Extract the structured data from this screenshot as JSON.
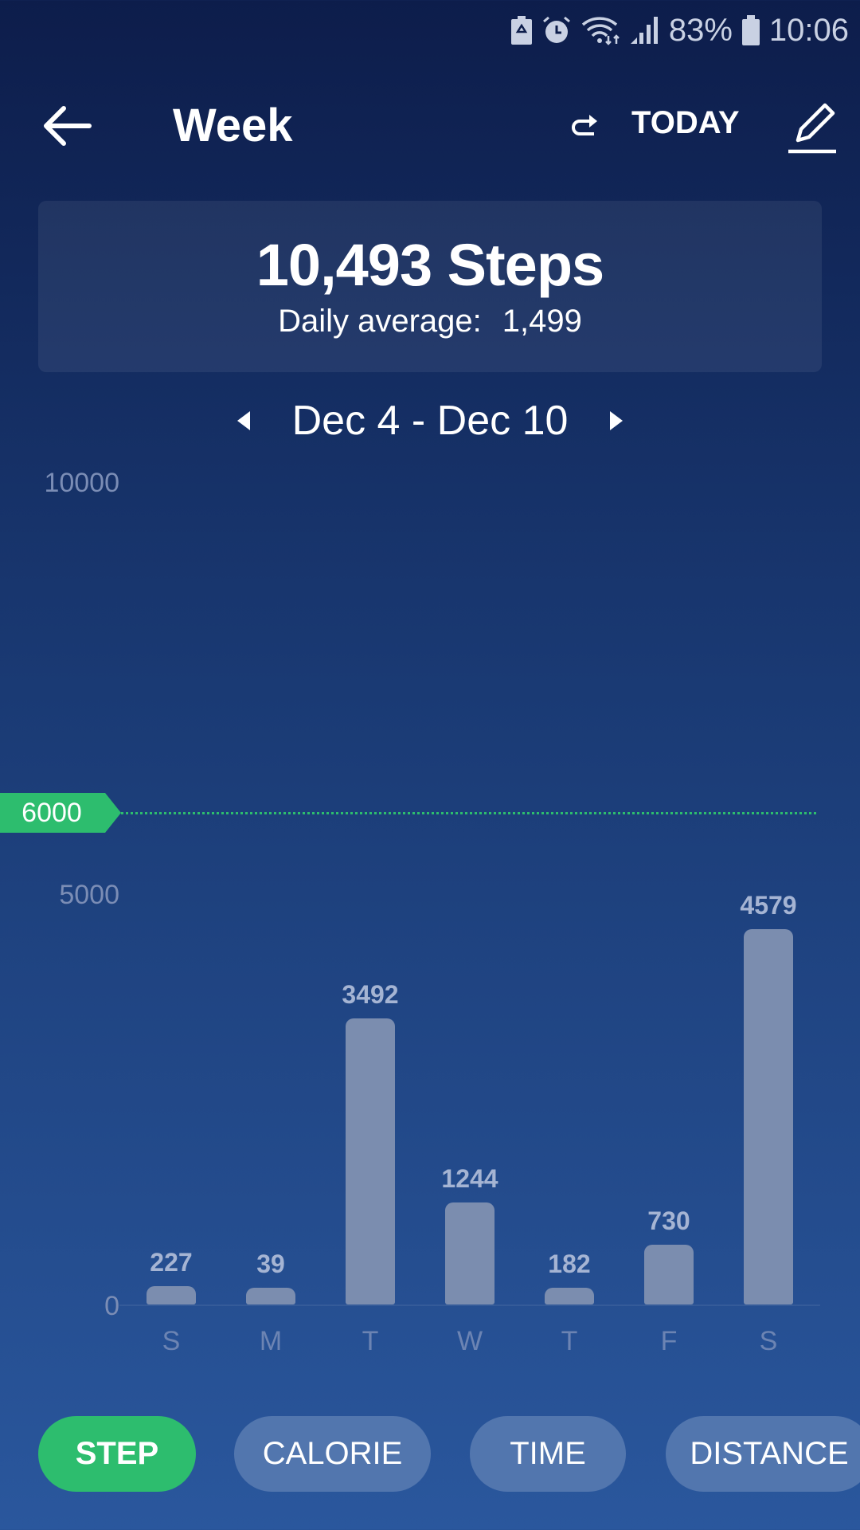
{
  "status_bar": {
    "battery_percent": "83%",
    "time": "10:06",
    "icons": [
      "battery-saver-icon",
      "alarm-icon",
      "wifi-icon",
      "signal-icon",
      "battery-icon"
    ]
  },
  "header": {
    "title": "Week",
    "today_label": "TODAY",
    "icons": [
      "back-arrow-icon",
      "refresh-icon",
      "edit-icon"
    ]
  },
  "summary": {
    "total": "10,493 Steps",
    "average_label": "Daily average:",
    "average_value": "1,499"
  },
  "date_range": {
    "label": "Dec 4 - Dec 10"
  },
  "colors": {
    "accent": "#2dbd6e",
    "bar": "#7b8daf",
    "pill": "#5276ae"
  },
  "chart_data": {
    "type": "bar",
    "categories": [
      "S",
      "M",
      "T",
      "W",
      "T",
      "F",
      "S"
    ],
    "values": [
      227,
      39,
      3492,
      1244,
      182,
      730,
      4579
    ],
    "value_labels": [
      "227",
      "39",
      "3492",
      "1244",
      "182",
      "730",
      "4579"
    ],
    "ylim": [
      0,
      10000
    ],
    "yticks": [
      "10000",
      "5000",
      "0"
    ],
    "goal": {
      "value": 6000,
      "label": "6000"
    },
    "grid": false
  },
  "tabs": [
    {
      "label": "STEP",
      "active": true
    },
    {
      "label": "CALORIE",
      "active": false
    },
    {
      "label": "TIME",
      "active": false
    },
    {
      "label": "DISTANCE",
      "active": false
    }
  ]
}
